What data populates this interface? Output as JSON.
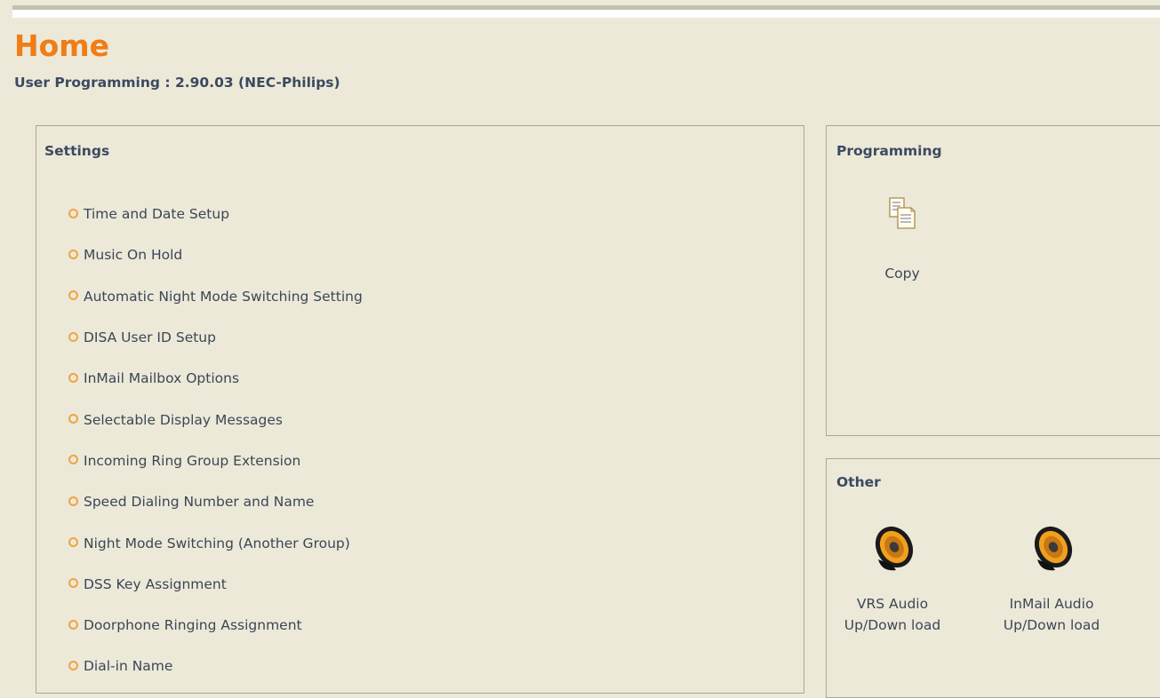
{
  "header": {
    "title": "Home",
    "subtitle": "User Programming : 2.90.03 (NEC-Philips)"
  },
  "settings": {
    "title": "Settings",
    "items": [
      "Time and Date Setup",
      "Music On Hold",
      "Automatic Night Mode Switching Setting",
      "DISA User ID Setup",
      "InMail Mailbox Options",
      "Selectable Display Messages",
      "Incoming Ring Group Extension",
      "Speed Dialing Number and Name",
      "Night Mode Switching (Another Group)",
      "DSS Key Assignment",
      "Doorphone Ringing Assignment",
      "Dial-in Name"
    ]
  },
  "programming": {
    "title": "Programming",
    "copy_label": "Copy"
  },
  "other": {
    "title": "Other",
    "vrs_label": "VRS Audio Up/Down load",
    "inmail_label": "InMail Audio Up/Down load"
  },
  "colors": {
    "title_orange": "#f07d16",
    "bullet_orange": "#f0a442",
    "heading_blue": "#3b4a60",
    "background": "#ece9d8"
  },
  "icons": {
    "bullet": "circle-bullet-icon",
    "copy": "copy-documents-icon",
    "speaker": "speaker-icon"
  }
}
